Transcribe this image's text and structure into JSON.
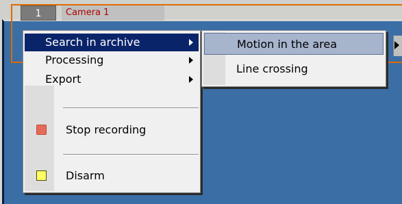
{
  "camera": {
    "number": "1",
    "title": "Camera 1"
  },
  "context_menu": {
    "items": [
      {
        "label": "Search in archive",
        "has_submenu": true,
        "selected": true
      },
      {
        "label": "Processing",
        "has_submenu": true
      },
      {
        "label": "Export",
        "has_submenu": true
      },
      {
        "label": "Stop recording",
        "icon": "stop-recording-icon",
        "icon_color": "#e46a5a"
      },
      {
        "label": "Disarm",
        "icon": "disarm-icon",
        "icon_color": "#ffff66"
      }
    ]
  },
  "submenu": {
    "items": [
      {
        "label": "Motion in the area",
        "hovered": true
      },
      {
        "label": "Line crossing"
      }
    ]
  },
  "colors": {
    "selection": "#0a246a",
    "hover": "#a6b4cc",
    "camera_panel": "#3b6ea5",
    "camera_frame": "#e06a00",
    "camera_title_text": "#b00000"
  }
}
